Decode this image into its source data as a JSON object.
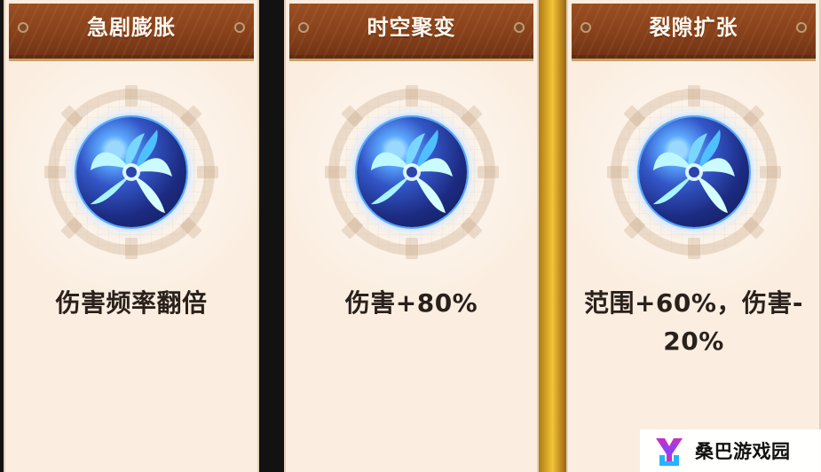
{
  "cards": [
    {
      "title": "急剧膨胀",
      "effect": "伤害频率翻倍",
      "icon": "vortex-orb-icon"
    },
    {
      "title": "时空聚变",
      "effect": "伤害+80%",
      "icon": "vortex-orb-icon"
    },
    {
      "title": "裂隙扩张",
      "effect": "范围+60%，伤害-20%",
      "effect_line1": "范围+60%，伤害-",
      "effect_line2": "20%",
      "icon": "vortex-orb-icon"
    }
  ],
  "watermark": {
    "site_name": "桑巴游戏园",
    "logo_icon": "sangba-logo-icon"
  },
  "colors": {
    "header_brown": "#87401a",
    "card_bg": "#fbeee0",
    "gold_divider": "#f2c33a",
    "text_dark": "#2a211c",
    "orb_blue": "#3356c7"
  }
}
